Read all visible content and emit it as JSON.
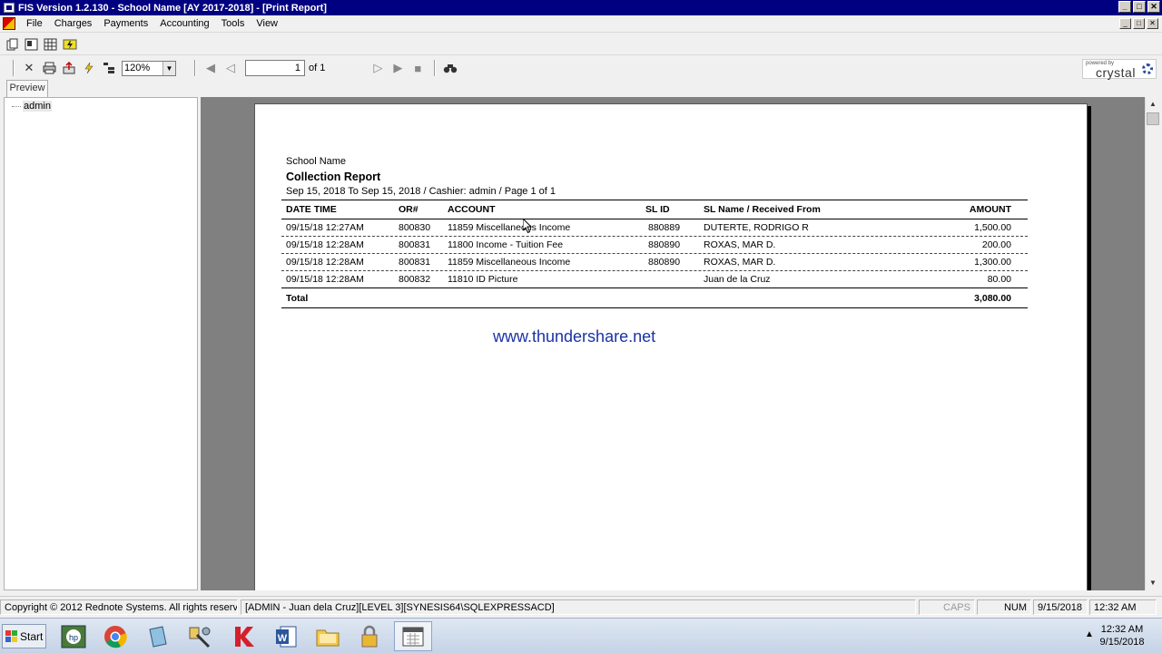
{
  "window": {
    "title": "FIS Version 1.2.130 - School Name [AY 2017-2018] - [Print Report]"
  },
  "menu": {
    "items": [
      "File",
      "Charges",
      "Payments",
      "Accounting",
      "Tools",
      "View"
    ]
  },
  "viewer_toolbar": {
    "zoom": "120%",
    "page_current": "1",
    "page_of": "of 1",
    "logo_powered": "powered by",
    "logo_name": "crystal"
  },
  "tabs": {
    "preview": "Preview"
  },
  "tree": {
    "root_label": "admin"
  },
  "report": {
    "school": "School Name",
    "title": "Collection Report",
    "subtitle": "Sep 15, 2018 To Sep 15, 2018 / Cashier: admin / Page 1 of 1",
    "headers": {
      "date_time": "DATE TIME",
      "or_no": "OR#",
      "account": "ACCOUNT",
      "sl_id": "SL ID",
      "sl_name": "SL Name / Received From",
      "amount": "AMOUNT"
    },
    "rows": [
      {
        "date_time": "09/15/18  12:27AM",
        "or_no": "800830",
        "account": "11859 Miscellaneous Income",
        "sl_id": "880889",
        "sl_name": "DUTERTE, RODRIGO R",
        "amount": "1,500.00"
      },
      {
        "date_time": "09/15/18  12:28AM",
        "or_no": "800831",
        "account": "11800 Income - Tuition Fee",
        "sl_id": "880890",
        "sl_name": "ROXAS, MAR D.",
        "amount": "200.00"
      },
      {
        "date_time": "09/15/18  12:28AM",
        "or_no": "800831",
        "account": "11859 Miscellaneous Income",
        "sl_id": "880890",
        "sl_name": "ROXAS, MAR D.",
        "amount": "1,300.00"
      },
      {
        "date_time": "09/15/18  12:28AM",
        "or_no": "800832",
        "account": "11810 ID Picture",
        "sl_id": "",
        "sl_name": "Juan de la Cruz",
        "amount": "80.00"
      }
    ],
    "total_label": "Total",
    "total_amount": "3,080.00",
    "watermark": "www.thundershare.net"
  },
  "statusbar": {
    "copyright": "Copyright © 2012 Rednote Systems. All rights reserved.",
    "session": "[ADMIN - Juan dela Cruz][LEVEL 3][SYNESIS64\\SQLEXPRESSACD]",
    "caps": "CAPS",
    "num": "NUM",
    "date": "9/15/2018",
    "time": "12:32 AM"
  },
  "taskbar": {
    "start": "Start",
    "clock_time": "12:32 AM",
    "clock_date": "9/15/2018",
    "apps": [
      "hp-icon",
      "chrome-icon",
      "notepad-icon",
      "tools-icon",
      "kaspersky-icon",
      "word-icon",
      "folder-icon",
      "lock-icon",
      "calendar-icon"
    ]
  },
  "colors": {
    "titlebar": "#000080",
    "report_bg": "#808080",
    "watermark": "#1a33a6"
  }
}
